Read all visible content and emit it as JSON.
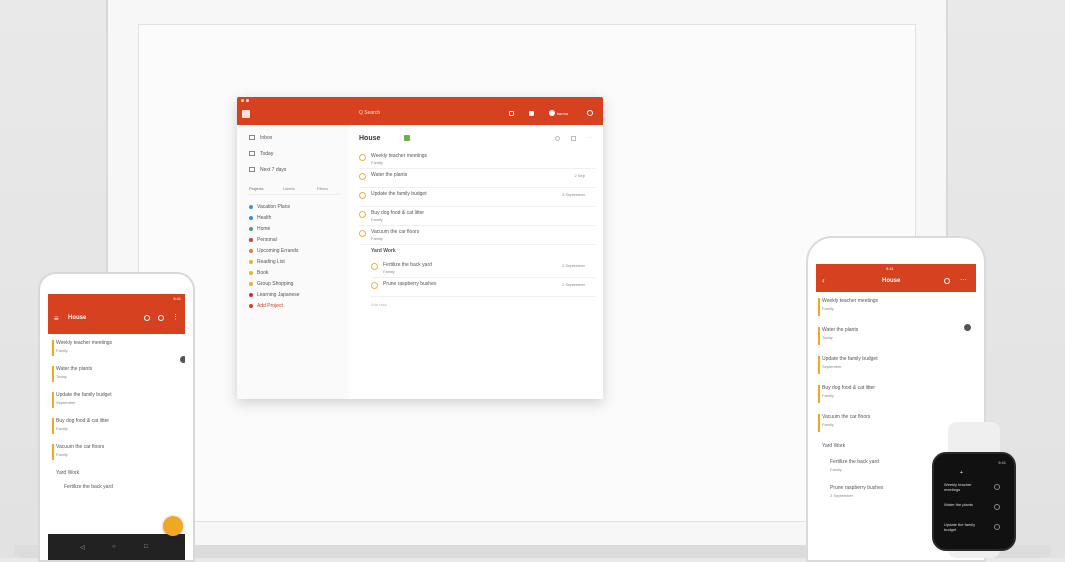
{
  "colors": {
    "accent": "#d6411f",
    "fab": "#f0a823"
  },
  "desktop": {
    "search_label": "Q Search",
    "karma_label": "karma",
    "sidebar": {
      "nav": [
        {
          "label": "Inbox"
        },
        {
          "label": "Today"
        },
        {
          "label": "Next 7 days"
        }
      ],
      "tabs": [
        "Projects",
        "Labels",
        "Filters"
      ],
      "projects": [
        {
          "name": "Vacation Plans",
          "color": "#4a90d9"
        },
        {
          "name": "Health",
          "color": "#3a8fd0"
        },
        {
          "name": "Home",
          "color": "#4aa36a"
        },
        {
          "name": "Personal",
          "color": "#d04040"
        },
        {
          "name": "Upcoming Errands",
          "color": "#e07a3a"
        },
        {
          "name": "Reading List",
          "color": "#e0b63a"
        },
        {
          "name": "Book",
          "color": "#e0b63a"
        },
        {
          "name": "Group Shopping",
          "color": "#e0b63a"
        },
        {
          "name": "Learning Japanese",
          "color": "#c0392b"
        },
        {
          "name": "Add Project",
          "color": "#d6411f"
        }
      ]
    },
    "project_title": "House",
    "tasks": [
      {
        "title": "Weekly teacher meetings",
        "sub": "Family",
        "meta": ""
      },
      {
        "title": "Water the plants",
        "sub": "",
        "meta": "2 Sep"
      },
      {
        "title": "Update the family budget",
        "sub": "",
        "meta": "3 September"
      },
      {
        "title": "Buy dog food & cat litter",
        "sub": "Family",
        "meta": ""
      },
      {
        "title": "Vacuum the car floors",
        "sub": "Family",
        "meta": ""
      }
    ],
    "section": "Yard Work",
    "section_tasks": [
      {
        "title": "Fertilize the back yard",
        "sub": "Family",
        "meta": "2 September"
      },
      {
        "title": "Prune raspberry bushes",
        "sub": "",
        "meta": "2 September"
      }
    ],
    "add_task": "Add task"
  },
  "android": {
    "status": "9:41",
    "title": "House",
    "tasks": [
      {
        "title": "Weekly teacher meetings",
        "sub": "Family"
      },
      {
        "title": "Water the plants",
        "sub": "Today"
      },
      {
        "title": "Update the family budget",
        "sub": "September"
      },
      {
        "title": "Buy dog food & cat litter",
        "sub": "Family"
      },
      {
        "title": "Vacuum the car floors",
        "sub": "Family"
      }
    ],
    "section": "Yard Work",
    "section_task": "Fertilize the back yard"
  },
  "ios": {
    "status": "9:41",
    "title": "House",
    "tasks": [
      {
        "title": "Weekly teacher meetings",
        "sub": "Family"
      },
      {
        "title": "Water the plants",
        "sub": "Today"
      },
      {
        "title": "Update the family budget",
        "sub": "September"
      },
      {
        "title": "Buy dog food & cat litter",
        "sub": "Family"
      },
      {
        "title": "Vacuum the car floors",
        "sub": "Family"
      }
    ],
    "section": "Yard Work",
    "section_tasks": [
      {
        "title": "Fertilize the back yard",
        "sub": "Family"
      },
      {
        "title": "Prune raspberry bushes",
        "sub": "2 September"
      }
    ]
  },
  "watch": {
    "time": "9:41",
    "items": [
      {
        "title": "Weekly teacher meetings"
      },
      {
        "title": "Water the plants"
      },
      {
        "title": "Update the family budget"
      }
    ]
  }
}
